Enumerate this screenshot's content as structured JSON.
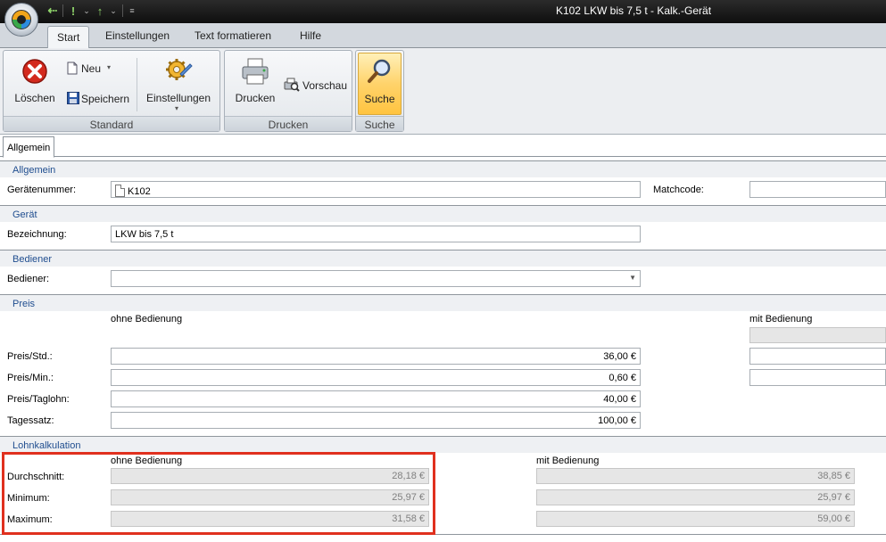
{
  "window": {
    "title": "K102 LKW bis 7,5 t - Kalk.-Gerät"
  },
  "qat": {
    "icons": [
      "back-arrow-icon",
      "exclamation-icon",
      "up-arrow-icon",
      "customize-icon"
    ]
  },
  "ribbon": {
    "tabs": [
      {
        "label": "Start",
        "active": true
      },
      {
        "label": "Einstellungen"
      },
      {
        "label": "Text formatieren"
      },
      {
        "label": "Hilfe"
      }
    ],
    "groups": {
      "standard": {
        "label": "Standard",
        "loeschen": "Löschen",
        "neu": "Neu",
        "speichern": "Speichern",
        "einstellungen": "Einstellungen"
      },
      "drucken": {
        "label": "Drucken",
        "drucken": "Drucken",
        "vorschau": "Vorschau"
      },
      "suche": {
        "label": "Suche",
        "suche": "Suche"
      }
    }
  },
  "doc_tab": "Allgemein",
  "colors": {
    "section_header": "#1f4d8f",
    "highlight": "#e0301e",
    "suche_active": "#ffd36b"
  },
  "sections": {
    "allgemein": {
      "title": "Allgemein",
      "geraetenummer_label": "Gerätenummer:",
      "geraetenummer_value": "K102",
      "matchcode_label": "Matchcode:",
      "matchcode_value": ""
    },
    "geraet": {
      "title": "Gerät",
      "bezeichnung_label": "Bezeichnung:",
      "bezeichnung_value": "LKW bis 7,5 t"
    },
    "bediener": {
      "title": "Bediener",
      "bediener_label": "Bediener:",
      "bediener_value": ""
    },
    "preis": {
      "title": "Preis",
      "col_ohne": "ohne Bedienung",
      "col_mit": "mit Bedienung",
      "rows": [
        {
          "label": "Preis/Std.:",
          "ohne": "36,00 €",
          "mit": ""
        },
        {
          "label": "Preis/Min.:",
          "ohne": "0,60 €",
          "mit": ""
        },
        {
          "label": "Preis/Taglohn:",
          "ohne": "40,00 €"
        },
        {
          "label": "Tagessatz:",
          "ohne": "100,00 €"
        }
      ]
    },
    "lohnkalkulation": {
      "title": "Lohnkalkulation",
      "col_ohne": "ohne Bedienung",
      "col_mit": "mit Bedienung",
      "rows": [
        {
          "label": "Durchschnitt:",
          "ohne": "28,18 €",
          "mit": "38,85 €"
        },
        {
          "label": "Minimum:",
          "ohne": "25,97 €",
          "mit": "25,97 €"
        },
        {
          "label": "Maximum:",
          "ohne": "31,58 €",
          "mit": "59,00 €"
        }
      ]
    }
  }
}
